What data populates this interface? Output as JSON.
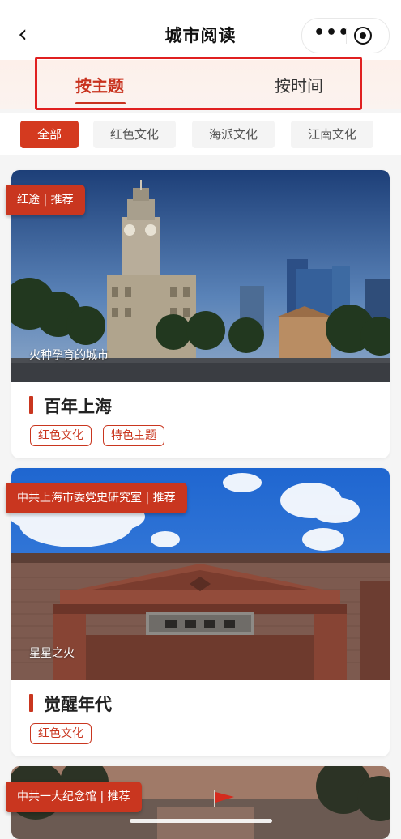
{
  "nav": {
    "back_icon": "chevron-left-icon",
    "title": "城市阅读",
    "more_icon": "more-dots-icon",
    "close_icon": "record-circle-icon"
  },
  "tabs": [
    {
      "label": "按主题",
      "active": true
    },
    {
      "label": "按时间",
      "active": false
    }
  ],
  "filters": [
    {
      "label": "全部",
      "active": true
    },
    {
      "label": "红色文化",
      "active": false
    },
    {
      "label": "海派文化",
      "active": false
    },
    {
      "label": "江南文化",
      "active": false
    }
  ],
  "cards": [
    {
      "ribbon": "红途 | 推荐",
      "caption": "火种孕育的城市",
      "title": "百年上海",
      "tags": [
        "红色文化",
        "特色主题"
      ]
    },
    {
      "ribbon": "中共上海市委党史研究室 | 推荐",
      "caption": "星星之火",
      "title": "觉醒年代",
      "tags": [
        "红色文化"
      ]
    },
    {
      "ribbon": "中共一大纪念馆 | 推荐"
    }
  ],
  "colors": {
    "accent": "#c9361f",
    "highlight_box": "#e02020",
    "chip_bg": "#f4f4f4"
  }
}
